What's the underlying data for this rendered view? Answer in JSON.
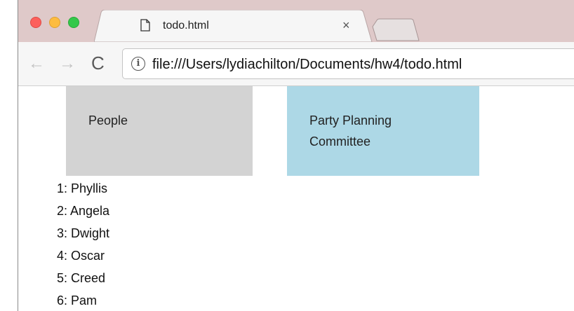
{
  "browser": {
    "tabs": [
      {
        "title": "todo.html",
        "close": "×",
        "page_icon": "document-icon"
      }
    ],
    "nav": {
      "back": "←",
      "forward": "→",
      "reload": "C"
    },
    "address": {
      "info": "i",
      "url": "file:///Users/lydiachilton/Documents/hw4/todo.html"
    }
  },
  "page": {
    "boxes": [
      {
        "label": "People",
        "color": "#d3d3d3"
      },
      {
        "label": "Party Planning Committee",
        "color": "#add8e6"
      }
    ],
    "people": [
      "1: Phyllis",
      "2: Angela",
      "3: Dwight",
      "4: Oscar",
      "5: Creed",
      "6: Pam"
    ]
  },
  "colors": {
    "titlebar": "#dfc9c9",
    "close": "#fc605c",
    "minimize": "#fdbc40",
    "maximize": "#34c84a"
  }
}
